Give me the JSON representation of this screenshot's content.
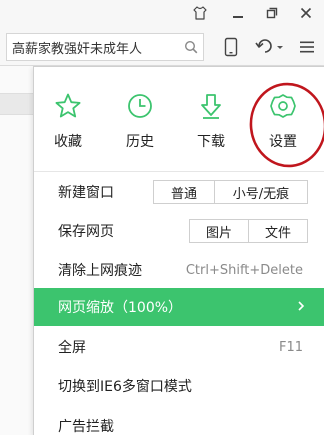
{
  "window": {
    "controls": [
      "shirt-icon",
      "minimize-icon",
      "restore-icon",
      "close-icon"
    ]
  },
  "toolbar": {
    "address_text": "高薪家教强奸未成年人",
    "icons": [
      "search-icon",
      "phone-icon",
      "undo-icon",
      "menu-icon"
    ]
  },
  "quick": [
    {
      "label": "收藏",
      "icon": "star-icon"
    },
    {
      "label": "历史",
      "icon": "clock-icon"
    },
    {
      "label": "下载",
      "icon": "download-icon"
    },
    {
      "label": "设置",
      "icon": "gear-icon"
    }
  ],
  "menu": {
    "new_window": {
      "label": "新建窗口",
      "options": [
        "普通",
        "小号/无痕"
      ]
    },
    "save_page": {
      "label": "保存网页",
      "options": [
        "图片",
        "文件"
      ]
    },
    "clear_traces": {
      "label": "清除上网痕迹",
      "shortcut": "Ctrl+Shift+Delete"
    },
    "zoom": {
      "label": "网页缩放（100%）"
    },
    "fullscreen": {
      "label": "全屏",
      "shortcut": "F11"
    },
    "ie6_mode": {
      "label": "切换到IE6多窗口模式"
    },
    "ad_block": {
      "label": "广告拦截"
    }
  },
  "colors": {
    "accent": "#3cc46e",
    "annotation": "#c0161d"
  }
}
